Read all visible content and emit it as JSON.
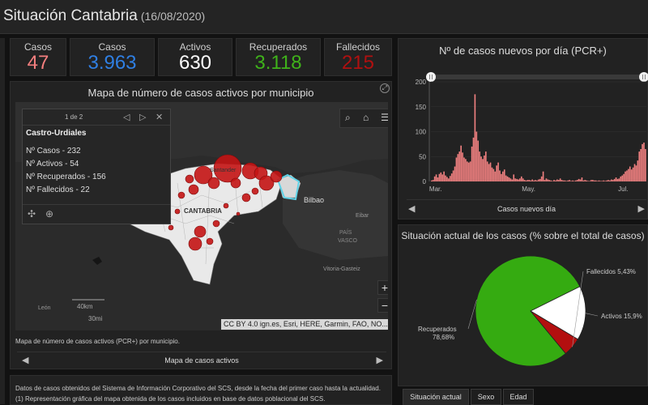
{
  "header": {
    "title": "Situación Cantabria",
    "date": "(16/08/2020)"
  },
  "stats": [
    {
      "label": "Casos",
      "value": "47",
      "color": "#f47f7f"
    },
    {
      "label": "Casos",
      "value": "3.963",
      "color": "#2f7fe3"
    },
    {
      "label": "Activos",
      "value": "630",
      "color": "#ffffff"
    },
    {
      "label": "Recuperados",
      "value": "3.118",
      "color": "#3fb21a"
    },
    {
      "label": "Fallecidos",
      "value": "215",
      "color": "#b01010"
    }
  ],
  "map_panel": {
    "title": "Mapa de número de casos activos por municipio",
    "caption": "Mapa de número de casos activos (PCR+) por municipio.",
    "nav_label": "Mapa de casos activos",
    "attribution": "CC BY 4.0 ign.es, Esri, HERE, Garmin, FAO, NO...",
    "zoom_in": "+",
    "zoom_out": "−",
    "popup": {
      "pager": "1 de 2",
      "title": "Castro-Urdiales",
      "rows": [
        "Nº Casos - 232",
        "Nº Activos - 54",
        "Nº Recuperados - 156",
        "Nº Fallecidos - 22"
      ]
    },
    "place_labels": {
      "santander": "Santander",
      "cantabria": "CANTABRIA",
      "bilbao": "Bilbao",
      "eibar": "Eibar",
      "pais": "PAÍS",
      "vasco": "VASCO",
      "vitoria": "Vitoria-Gasteiz",
      "leon": "León",
      "scale_km": "40km",
      "scale_mi": "30mi"
    }
  },
  "info": {
    "line1": "Datos de casos obtenidos del Sistema de Información Corporativo del SCS, desde la fecha del primer caso hasta la actualidad.",
    "line2": "(1) Representación gráfica del mapa obtenida de los casos incluidos en base de datos poblacional del SCS."
  },
  "bar_panel": {
    "title": "Nº de casos nuevos por día (PCR+)",
    "nav_label": "Casos nuevos día"
  },
  "pie_panel": {
    "title": "Situación actual de los casos (% sobre el total de casos)",
    "tabs": [
      "Situación actual",
      "Sexo",
      "Edad"
    ]
  },
  "chart_data": [
    {
      "type": "bar",
      "title": "Nº de casos nuevos por día (PCR+)",
      "xlabel": "Casos nuevos día",
      "ylabel": "",
      "ylim": [
        0,
        200
      ],
      "yticks": [
        0,
        50,
        100,
        150,
        200
      ],
      "x_tick_labels": [
        "Mar.",
        "May.",
        "Jul."
      ],
      "x_tick_index": [
        3,
        63,
        124
      ],
      "color": "#f08080",
      "values": [
        2,
        3,
        10,
        14,
        8,
        15,
        18,
        14,
        20,
        12,
        9,
        6,
        11,
        16,
        22,
        30,
        48,
        55,
        60,
        72,
        58,
        48,
        45,
        40,
        38,
        40,
        70,
        88,
        175,
        100,
        82,
        60,
        50,
        45,
        52,
        60,
        40,
        35,
        38,
        28,
        25,
        20,
        32,
        38,
        22,
        15,
        20,
        24,
        12,
        10,
        8,
        6,
        4,
        14,
        6,
        5,
        4,
        6,
        10,
        6,
        3,
        2,
        3,
        3,
        2,
        4,
        2,
        3,
        2,
        4,
        5,
        10,
        20,
        3,
        6,
        4,
        3,
        2,
        1,
        3,
        2,
        4,
        3,
        6,
        3,
        2,
        2,
        1,
        2,
        3,
        1,
        2,
        1,
        2,
        3,
        5,
        4,
        8,
        2,
        3,
        2,
        1,
        1,
        3,
        3,
        2,
        2,
        1,
        2,
        1,
        1,
        2,
        1,
        2,
        3,
        2,
        4,
        3,
        5,
        8,
        5,
        6,
        10,
        12,
        15,
        20,
        22,
        25,
        30,
        24,
        28,
        35,
        32,
        42,
        60,
        65,
        75,
        78,
        65
      ]
    },
    {
      "type": "pie",
      "title": "Situación actual de los casos (% sobre el total de casos)",
      "slices": [
        {
          "label": "Recuperados 78,68%",
          "value": 78.68,
          "color": "#35ab11"
        },
        {
          "label": "Activos 15,9%",
          "value": 15.9,
          "color": "#ffffff"
        },
        {
          "label": "Fallecidos 5,43%",
          "value": 5.43,
          "color": "#b30f0f"
        }
      ]
    }
  ]
}
